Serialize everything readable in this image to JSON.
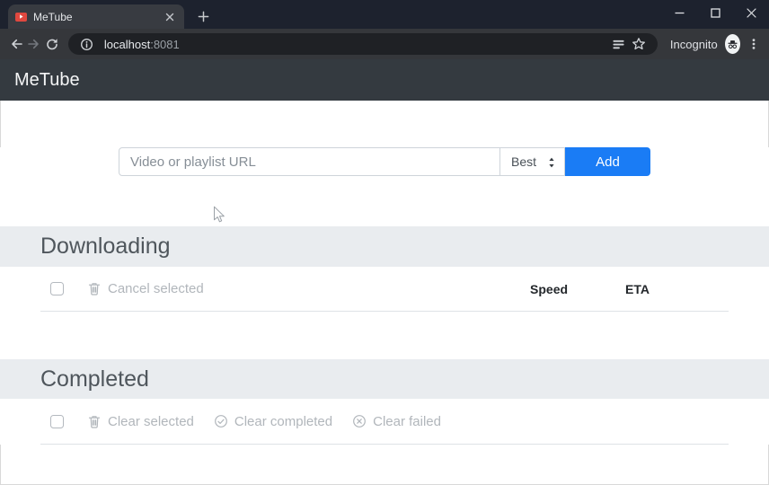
{
  "browser": {
    "tab": {
      "title": "MeTube"
    },
    "url": {
      "host": "localhost",
      "port": ":8081"
    },
    "incognito_label": "Incognito"
  },
  "app": {
    "navbar": {
      "brand": "MeTube"
    },
    "form": {
      "placeholder": "Video or playlist URL",
      "quality": "Best",
      "add_label": "Add"
    },
    "sections": {
      "downloading": {
        "title": "Downloading",
        "actions": [
          {
            "icon": "trash-icon",
            "label": "Cancel selected"
          }
        ],
        "columns": [
          "Speed",
          "ETA"
        ]
      },
      "completed": {
        "title": "Completed",
        "actions": [
          {
            "icon": "trash-icon",
            "label": "Clear selected"
          },
          {
            "icon": "check-circle-icon",
            "label": "Clear completed"
          },
          {
            "icon": "x-circle-icon",
            "label": "Clear failed"
          }
        ]
      }
    }
  },
  "colors": {
    "accent_blue": "#1a7cf5",
    "navbar_dark": "#343a40",
    "section_gray": "#e9ecef",
    "favicon_red": "#e0483f"
  }
}
